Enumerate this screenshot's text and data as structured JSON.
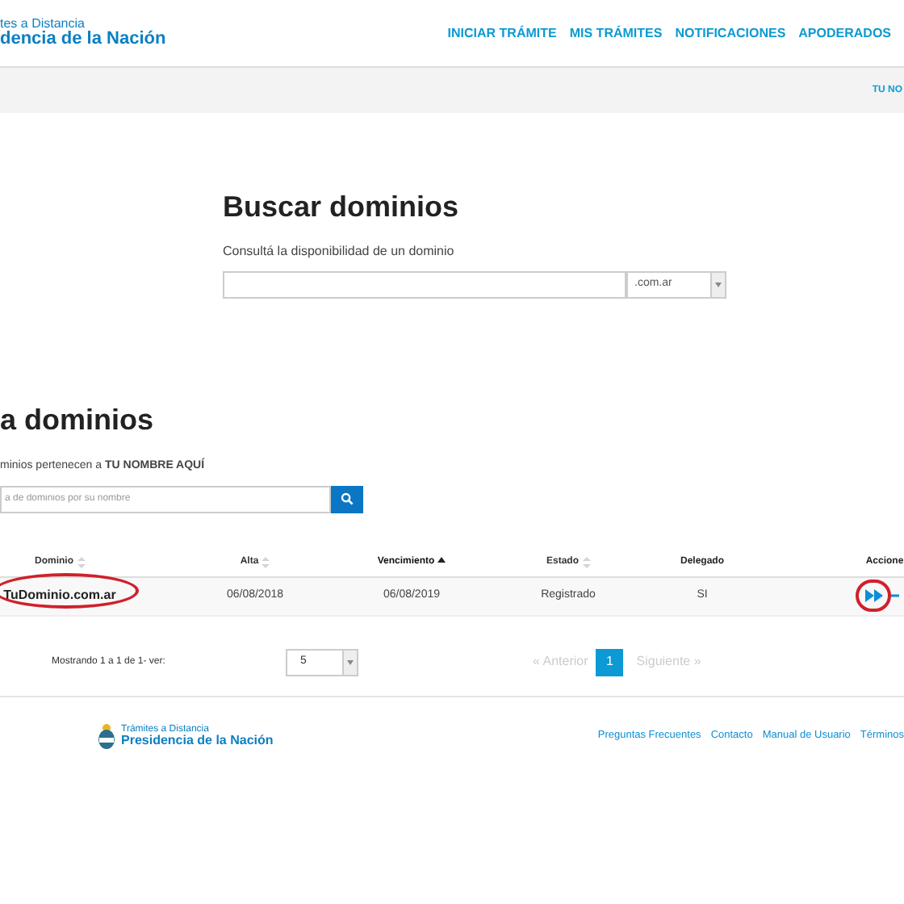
{
  "header": {
    "logo_line_1": "tes a Distancia",
    "logo_line_2": "dencia de la Nación",
    "nav": [
      {
        "label": "INICIAR TRÁMITE"
      },
      {
        "label": "MIS TRÁMITES"
      },
      {
        "label": "NOTIFICACIONES"
      },
      {
        "label": "APODERADOS"
      }
    ]
  },
  "user_bar": {
    "user": "TU NO"
  },
  "search_domains": {
    "title": "Buscar dominios",
    "subtitle": "Consultá la disponibilidad de un dominio",
    "suffix": ".com.ar"
  },
  "my_domains": {
    "title": "a dominios",
    "subtitle": "minios pertenecen a **TU NOMBRE AQUÍ**",
    "filter_placeholder": "a de dominios por su nombre"
  },
  "table": {
    "columns": [
      {
        "label": "Dominio",
        "sortable": true,
        "sorted": false
      },
      {
        "label": "Alta",
        "sortable": true,
        "sorted": false
      },
      {
        "label": "Vencimiento",
        "sortable": true,
        "sorted": true
      },
      {
        "label": "Estado",
        "sortable": true,
        "sorted": false
      },
      {
        "label": "Delegado",
        "sortable": false,
        "sorted": false
      },
      {
        "label": "Accione",
        "sortable": false,
        "sorted": false
      }
    ],
    "rows": [
      {
        "domain": "TuDominio.com.ar",
        "alta": "06/08/2018",
        "vencimiento": "06/08/2019",
        "estado": "Registrado",
        "delegado": "SI",
        "highlighted": true
      }
    ]
  },
  "pagination": {
    "summary": "Mostrando 1 a 1 de 1- ver:",
    "page_size": "5",
    "previous": {
      "label": "« Anterior",
      "disabled": true
    },
    "pages": [
      {
        "label": "1",
        "selected": true
      }
    ],
    "next": {
      "label": "Siguiente »",
      "disabled": true
    }
  },
  "footer": {
    "logo_line_1": "Trámites a Distancia",
    "logo_line_2": "Presidencia de la Nación",
    "links": [
      {
        "label": "Preguntas Frecuentes"
      },
      {
        "label": "Contacto"
      },
      {
        "label": "Manual de Usuario"
      },
      {
        "label": "Términos"
      }
    ]
  }
}
